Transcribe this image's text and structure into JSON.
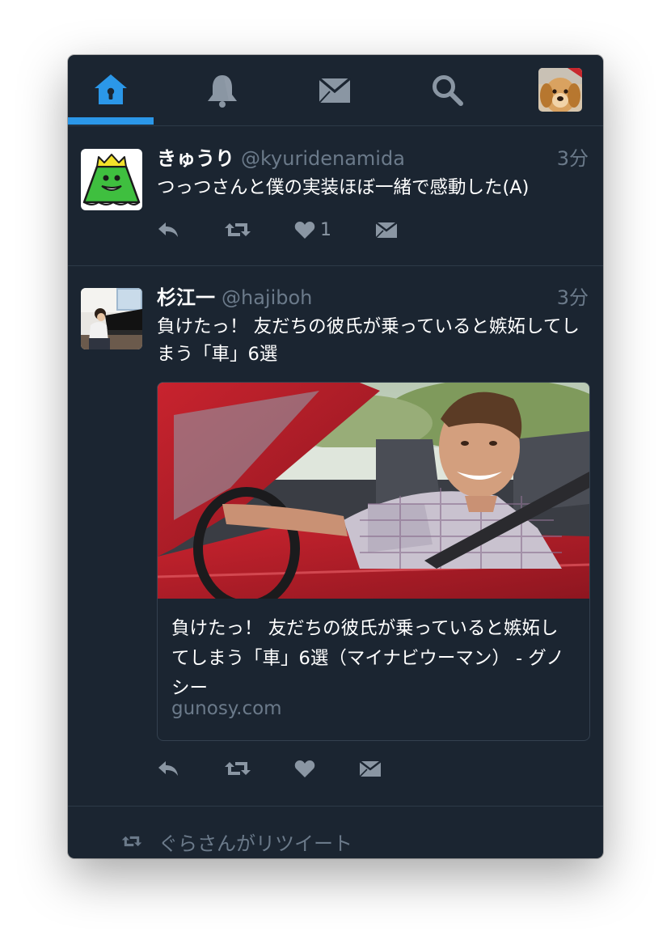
{
  "nav": {
    "tabs": [
      {
        "name": "home",
        "icon": "home-icon",
        "active": true
      },
      {
        "name": "notifications",
        "icon": "bell-icon",
        "active": false
      },
      {
        "name": "messages",
        "icon": "envelope-icon",
        "active": false
      },
      {
        "name": "search",
        "icon": "search-icon",
        "active": false
      }
    ],
    "profile_icon": "dog-avatar"
  },
  "tweets": [
    {
      "name": "きゅうり",
      "handle": "@kyuridenamida",
      "time": "3分",
      "text": "つっつさんと僕の実装ほぼ一緒で感動した(A)",
      "likes": "1",
      "avatar_icon": "green-mountain-crown-avatar"
    },
    {
      "name": "杉江一",
      "handle": "@hajiboh",
      "time": "3分",
      "text": "負けたっ！ 友だちの彼氏が乗っていると嫉妬してしまう「車」6選",
      "likes": "",
      "avatar_icon": "piano-player-avatar",
      "card": {
        "image": "man-in-red-convertible",
        "title": "負けたっ！ 友だちの彼氏が乗っていると嫉妬してしまう「車」6選（マイナビウーマン） - グノシー",
        "domain": "gunosy.com"
      }
    }
  ],
  "retweet_context": {
    "text": "ぐらさんがリツイート",
    "icon": "retweet-icon"
  },
  "colors": {
    "background": "#1b2531",
    "accent": "#2b97e8",
    "divider": "#2d3a48",
    "muted_text": "#6b7a8a",
    "icon_gray": "#8a96a3"
  }
}
